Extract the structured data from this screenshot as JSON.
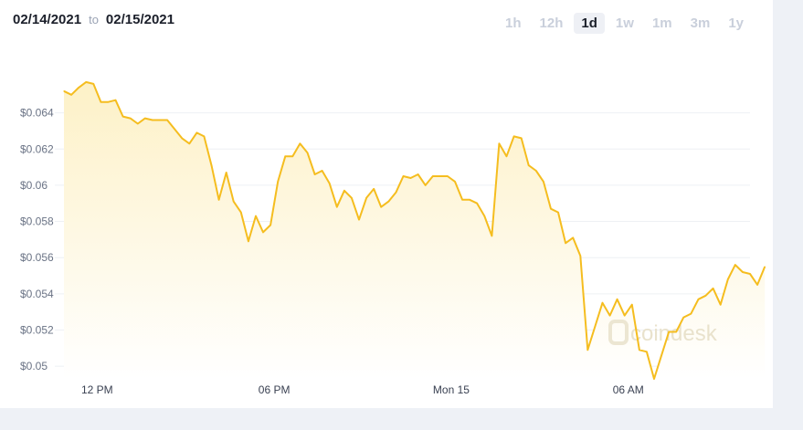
{
  "header": {
    "date_from": "02/14/2021",
    "to_label": "to",
    "date_to": "02/15/2021"
  },
  "ranges": [
    {
      "label": "1h",
      "active": false
    },
    {
      "label": "12h",
      "active": false
    },
    {
      "label": "1d",
      "active": true
    },
    {
      "label": "1w",
      "active": false
    },
    {
      "label": "1m",
      "active": false
    },
    {
      "label": "3m",
      "active": false
    },
    {
      "label": "1y",
      "active": false
    }
  ],
  "watermark": "coindesk",
  "colors": {
    "line": "#f5bd1f",
    "fill_top": "#fdf1c7",
    "fill_bottom": "#ffffff"
  },
  "chart_data": {
    "type": "area",
    "ylim": [
      0.0493,
      0.0662
    ],
    "yticks": [
      {
        "value": 0.05,
        "label": "$0.05"
      },
      {
        "value": 0.052,
        "label": "$0.052"
      },
      {
        "value": 0.054,
        "label": "$0.054"
      },
      {
        "value": 0.056,
        "label": "$0.056"
      },
      {
        "value": 0.058,
        "label": "$0.058"
      },
      {
        "value": 0.06,
        "label": "$0.06"
      },
      {
        "value": 0.062,
        "label": "$0.062"
      },
      {
        "value": 0.064,
        "label": "$0.064"
      }
    ],
    "xlim": [
      0,
      93
    ],
    "xticks": [
      {
        "value": 4.5,
        "label": "12 PM"
      },
      {
        "value": 28.5,
        "label": "06 PM"
      },
      {
        "value": 52.5,
        "label": "Mon 15"
      },
      {
        "value": 76.5,
        "label": "06 AM"
      }
    ],
    "values": [
      0.0652,
      0.065,
      0.0654,
      0.0657,
      0.0656,
      0.0646,
      0.0646,
      0.0647,
      0.0638,
      0.0637,
      0.0634,
      0.0637,
      0.0636,
      0.0636,
      0.0636,
      0.0631,
      0.0626,
      0.0623,
      0.0629,
      0.0627,
      0.0611,
      0.0592,
      0.0607,
      0.0591,
      0.0585,
      0.0569,
      0.0583,
      0.0574,
      0.0578,
      0.0602,
      0.0616,
      0.0616,
      0.0623,
      0.0618,
      0.0606,
      0.0608,
      0.0601,
      0.0588,
      0.0597,
      0.0593,
      0.0581,
      0.0593,
      0.0598,
      0.0588,
      0.0591,
      0.0596,
      0.0605,
      0.0604,
      0.0606,
      0.06,
      0.0605,
      0.0605,
      0.0605,
      0.0602,
      0.0592,
      0.0592,
      0.059,
      0.0583,
      0.0572,
      0.0623,
      0.0616,
      0.0627,
      0.0626,
      0.0611,
      0.0608,
      0.0602,
      0.0587,
      0.0585,
      0.0568,
      0.0571,
      0.0561,
      0.0509,
      0.0522,
      0.0535,
      0.0528,
      0.0537,
      0.0528,
      0.0534,
      0.0509,
      0.0508,
      0.0493,
      0.0506,
      0.0519,
      0.0519,
      0.0527,
      0.0529,
      0.0537,
      0.0539,
      0.0543,
      0.0534,
      0.0548,
      0.0556,
      0.0552,
      0.0551,
      0.0545,
      0.0555
    ]
  }
}
